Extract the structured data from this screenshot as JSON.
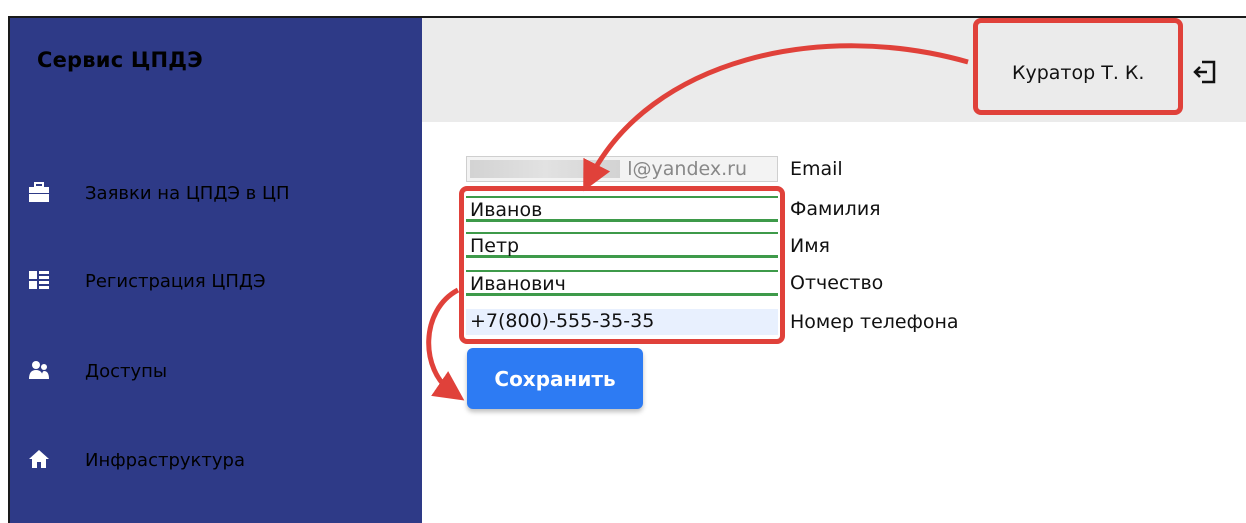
{
  "app": {
    "title": "Сервис ЦПДЭ"
  },
  "sidebar": {
    "items": [
      {
        "label": "Заявки на ЦПДЭ в ЦП",
        "icon": "briefcase-icon"
      },
      {
        "label": "Регистрация ЦПДЭ",
        "icon": "list-icon"
      },
      {
        "label": "Доступы",
        "icon": "users-icon"
      },
      {
        "label": "Инфраструктура",
        "icon": "home-icon"
      }
    ]
  },
  "header": {
    "user": "Куратор Т. К.",
    "logout_icon": "logout-icon"
  },
  "form": {
    "email": {
      "value": "l@yandex.ru",
      "label": "Email"
    },
    "last_name": {
      "value": "Иванов",
      "label": "Фамилия"
    },
    "first_name": {
      "value": "Петр",
      "label": "Имя"
    },
    "patronymic": {
      "value": "Иванович",
      "label": "Отчество"
    },
    "phone": {
      "value": "+7(800)-555-35-35",
      "label": "Номер телефона"
    },
    "save_label": "Сохранить"
  },
  "colors": {
    "sidebar": "#2e3a87",
    "header": "#ebebeb",
    "accent": "#2d7bf3",
    "annotation": "#e0413a",
    "field_border": "#3e9a4a"
  }
}
